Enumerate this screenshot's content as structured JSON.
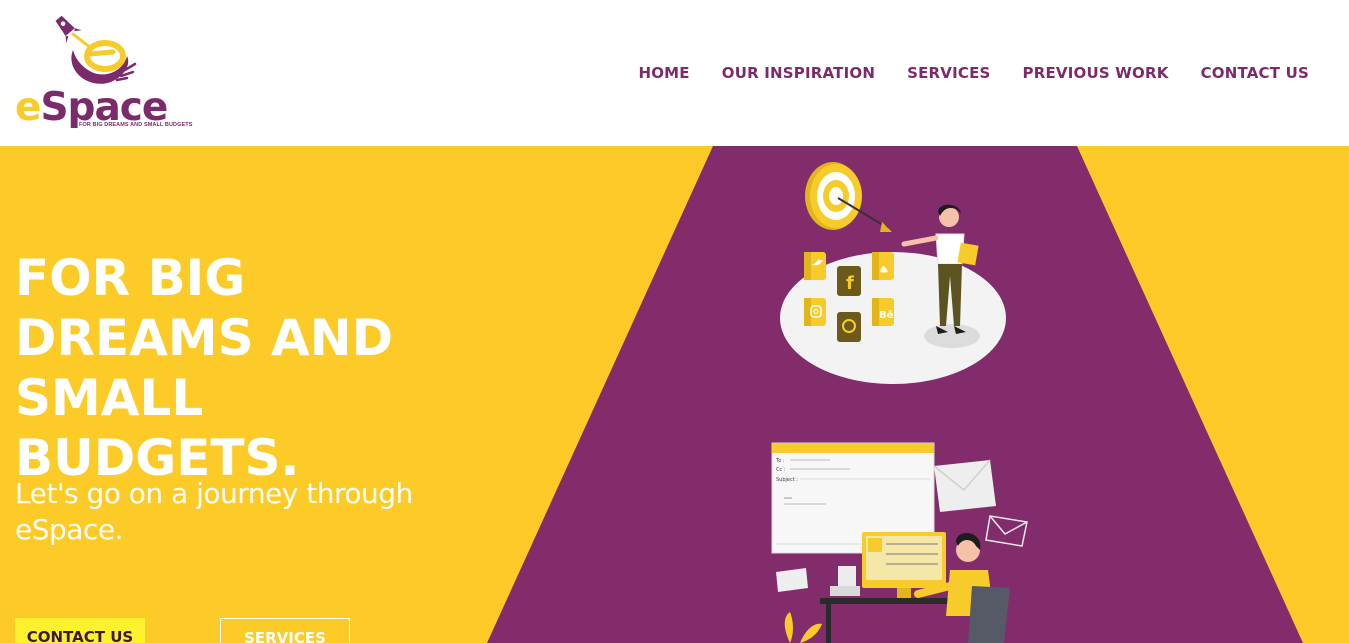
{
  "brand": {
    "name_prefix": "e",
    "name_rest": "Space",
    "tagline": "FOR BIG DREAMS AND SMALL BUDGETS"
  },
  "nav": {
    "items": [
      "HOME",
      "OUR INSPIRATION",
      "SERVICES",
      "PREVIOUS WORK",
      "CONTACT US"
    ]
  },
  "hero": {
    "title": "FOR BIG DREAMS AND SMALL BUDGETS.",
    "subtitle": "Let's go on a journey through eSpace.",
    "cta_primary": "CONTACT US",
    "cta_secondary": "SERVICES"
  },
  "email_window": {
    "to_label": "To :",
    "cc_label": "Cc :",
    "subject_label": "Subject :"
  },
  "colors": {
    "brand_purple": "#7b2a6c",
    "brand_yellow": "#fccb27",
    "highlight_yellow": "#fff12b",
    "white": "#ffffff"
  },
  "icons": [
    "rocket-icon",
    "target-icon",
    "twitter-icon",
    "facebook-icon",
    "snapchat-icon",
    "instagram-icon",
    "pinterest-icon",
    "behance-icon",
    "envelope-icon"
  ]
}
